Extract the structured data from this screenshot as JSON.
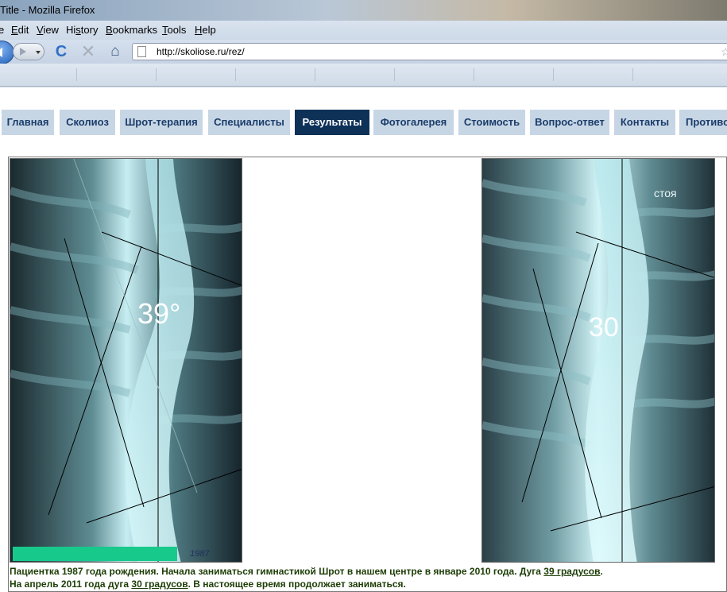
{
  "window": {
    "title": "Title - Mozilla Firefox"
  },
  "menu": [
    {
      "label": "e",
      "mnemonic": ""
    },
    {
      "label": "Edit",
      "mnemonic": "E"
    },
    {
      "label": "View",
      "mnemonic": "V"
    },
    {
      "label": "History",
      "mnemonic": "s"
    },
    {
      "label": "Bookmarks",
      "mnemonic": "B"
    },
    {
      "label": "Tools",
      "mnemonic": "T"
    },
    {
      "label": "Help",
      "mnemonic": "H"
    }
  ],
  "toolbar": {
    "back_icon": "back-arrow-icon",
    "forward_icon": "forward-arrow-icon",
    "reload_glyph": "C",
    "stop_glyph": "✕",
    "home_glyph": "⌂",
    "url": "http://skoliose.ru/rez/",
    "bookmark_star": "☆"
  },
  "site_nav": [
    {
      "label": "Главная",
      "active": false
    },
    {
      "label": "Сколиоз",
      "active": false
    },
    {
      "label": "Шрот-терапия",
      "active": false
    },
    {
      "label": "Специалисты",
      "active": false
    },
    {
      "label": "Результаты",
      "active": true
    },
    {
      "label": "Фотогалерея",
      "active": false
    },
    {
      "label": "Стоимость",
      "active": false
    },
    {
      "label": "Вопрос-ответ",
      "active": false
    },
    {
      "label": "Контакты",
      "active": false
    },
    {
      "label": "Противо",
      "active": false
    }
  ],
  "xray_before": {
    "angle_label": "39°",
    "corner_scrawl": "1987"
  },
  "xray_after": {
    "angle_label": "30",
    "position_label": "стоя"
  },
  "caption": {
    "line1_prefix": "Пациентка 1987 года рождения. Начала заниматься гимнастикой Шрот в нашем центре в январе 2010 года. Дуга ",
    "line1_link": "39 градусов",
    "line1_suffix": ".",
    "line2_prefix": "На апрель 2011 года дуга ",
    "line2_link": "30 градусов",
    "line2_suffix": ". В настоящее время продолжает заниматься."
  },
  "colors": {
    "nav_tab_bg": "#c7d6e5",
    "nav_tab_text": "#1b3d6b",
    "nav_active_bg": "#0e3158",
    "caption_text": "#1c3d05",
    "highlight_bar": "#18c98c"
  }
}
